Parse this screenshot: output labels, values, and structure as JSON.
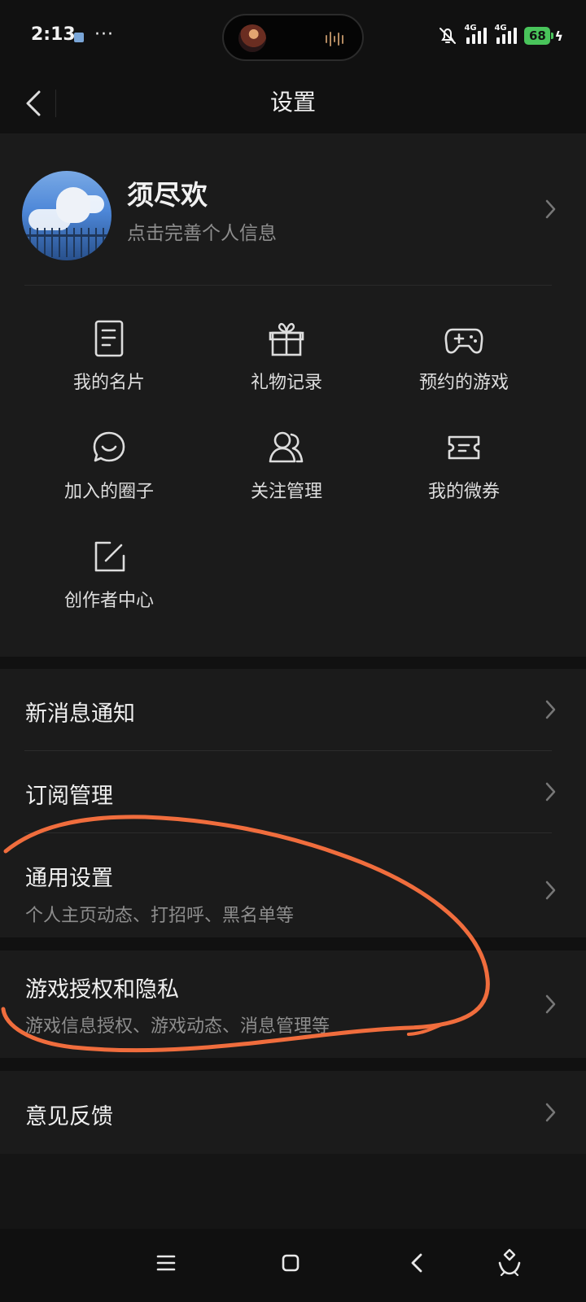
{
  "status_bar": {
    "time": "2:13",
    "more": "···",
    "battery": "68",
    "network_1": "4G",
    "network_2": "4G",
    "icons": [
      "app-notification-icon",
      "now-playing-cover",
      "audio-wave-icon",
      "silent-bell-icon",
      "signal-icon",
      "battery-icon",
      "charging-icon"
    ]
  },
  "header": {
    "title": "设置",
    "back_icon": "back-chevron-icon"
  },
  "profile": {
    "name": "须尽欢",
    "subtitle": "点击完善个人信息"
  },
  "shortcuts": [
    {
      "label": "我的名片",
      "icon": "card-document-icon"
    },
    {
      "label": "礼物记录",
      "icon": "gift-icon"
    },
    {
      "label": "预约的游戏",
      "icon": "gamepad-icon"
    },
    {
      "label": "加入的圈子",
      "icon": "chat-bubble-icon"
    },
    {
      "label": "关注管理",
      "icon": "users-icon"
    },
    {
      "label": "我的微券",
      "icon": "ticket-icon"
    },
    {
      "label": "创作者中心",
      "icon": "edit-square-icon"
    }
  ],
  "settings": [
    {
      "title": "新消息通知"
    },
    {
      "title": "订阅管理"
    },
    {
      "title": "通用设置",
      "subtitle": "个人主页动态、打招呼、黑名单等"
    }
  ],
  "privacy": {
    "title": "游戏授权和隐私",
    "subtitle": "游戏信息授权、游戏动态、消息管理等"
  },
  "feedback": {
    "title": "意见反馈"
  },
  "navigation": {
    "buttons": [
      "menu-icon",
      "home-square-icon",
      "back-icon",
      "assistant-icon"
    ]
  },
  "colors": {
    "background": "#111111",
    "panel": "#1b1b1b",
    "annotation": "#f06d3d",
    "battery": "#49c45b"
  }
}
